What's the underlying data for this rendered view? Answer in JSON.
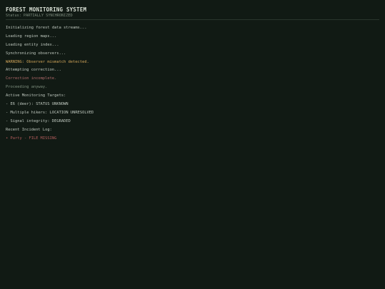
{
  "header": {
    "title": "FOREST MONITORING SYSTEM",
    "status": "Status: PARTIALLY SYNCHRONIZED"
  },
  "log": [
    {
      "text": "Initializing forest data streams...",
      "kind": "normal"
    },
    {
      "text": "Loading region maps...",
      "kind": "normal"
    },
    {
      "text": "Loading entity index...",
      "kind": "normal"
    },
    {
      "text": "Synchronizing observers...",
      "kind": "normal"
    },
    {
      "text": "WARNING: Observer mismatch detected.",
      "kind": "warn"
    },
    {
      "text": "Attempting correction...",
      "kind": "normal"
    },
    {
      "text": "Correction incomplete.",
      "kind": "error"
    },
    {
      "text": "Proceeding anyway.",
      "kind": "muted"
    },
    {
      "text": "Active Monitoring Targets:",
      "kind": "normal"
    },
    {
      "text": "- E6 (deer): STATUS UNKNOWN",
      "kind": "normal"
    },
    {
      "text": "- Multiple hikers: LOCATION UNRESOLVED",
      "kind": "normal"
    },
    {
      "text": "- Signal integrity: DEGRADED",
      "kind": "normal"
    },
    {
      "text": "Recent Incident Log:",
      "kind": "normal"
    },
    {
      "text": "• Party - FILE MISSING",
      "kind": "alert"
    }
  ]
}
